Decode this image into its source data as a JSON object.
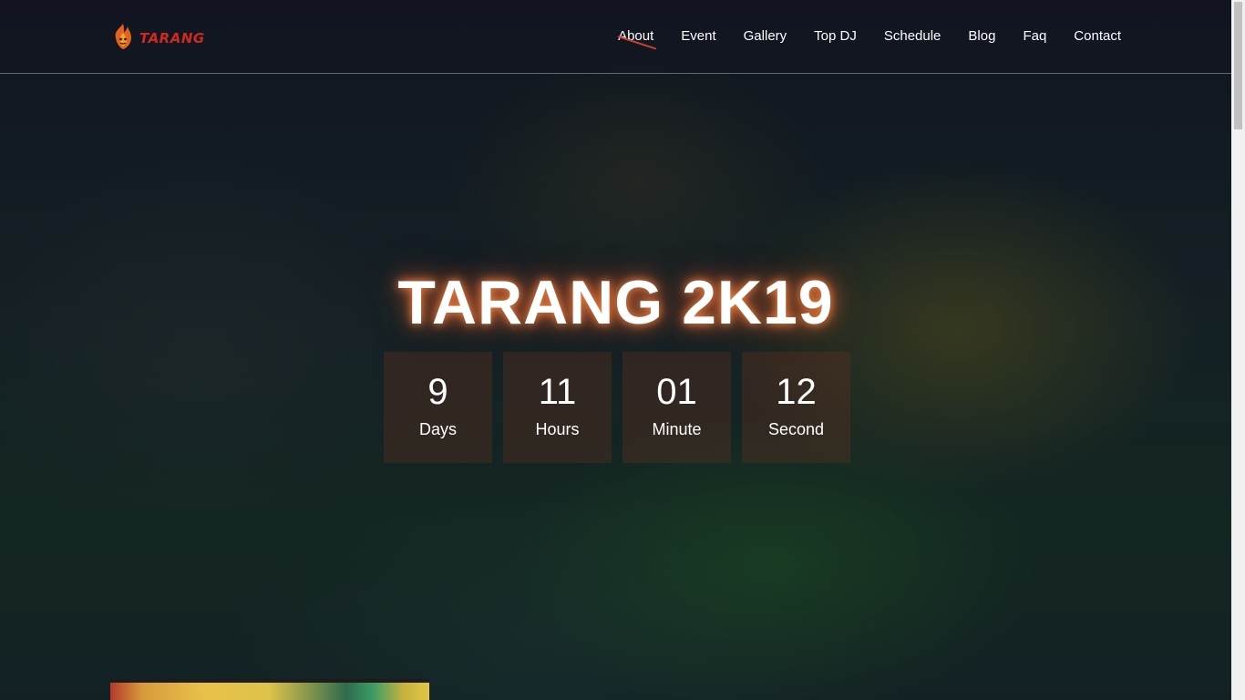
{
  "brand": {
    "name": "TARANG",
    "logo_icon": "flame-mascot-icon",
    "color": "#d02a1e"
  },
  "nav": {
    "items": [
      {
        "label": "About",
        "active": true
      },
      {
        "label": "Event"
      },
      {
        "label": "Gallery"
      },
      {
        "label": "Top DJ"
      },
      {
        "label": "Schedule"
      },
      {
        "label": "Blog"
      },
      {
        "label": "Faq"
      },
      {
        "label": "Contact"
      }
    ],
    "active_underline_color": "#c6412d"
  },
  "hero": {
    "title": "TARANG 2K19",
    "glow_color": "#ff7a3c"
  },
  "countdown": [
    {
      "value": "9",
      "label": "Days"
    },
    {
      "value": "11",
      "label": "Hours"
    },
    {
      "value": "01",
      "label": "Minute"
    },
    {
      "value": "12",
      "label": "Second"
    }
  ]
}
